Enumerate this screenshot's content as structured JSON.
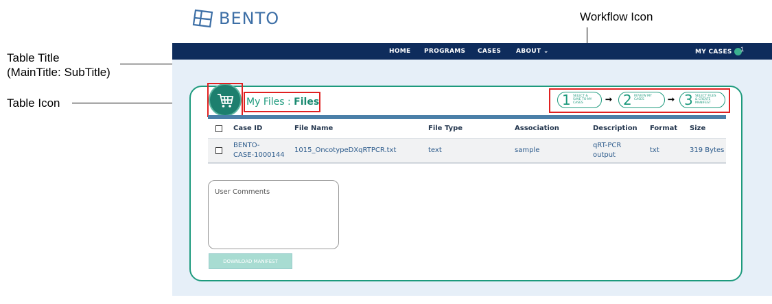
{
  "annotations": {
    "workflow_icon": "Workflow Icon",
    "table_title_line1": "Table Title",
    "table_title_line2": "(MainTitle: SubTitle)",
    "table_icon": "Table Icon"
  },
  "logo": {
    "text": "BENTO"
  },
  "nav": {
    "items": [
      "HOME",
      "PROGRAMS",
      "CASES",
      "ABOUT ⌄"
    ],
    "my_cases": "MY CASES",
    "cart_count": "1"
  },
  "title": {
    "main": "My Files : ",
    "sub": "Files"
  },
  "workflow": [
    {
      "num": "1",
      "text": "SELECT & SAVE TO MY CASES"
    },
    {
      "num": "2",
      "text": "REVIEW MY CASES"
    },
    {
      "num": "3",
      "text": "SELECT FILES & CREATE MANIFEST"
    }
  ],
  "table": {
    "headers": [
      "Case ID",
      "File Name",
      "File Type",
      "Association",
      "Description",
      "Format",
      "Size"
    ],
    "row": {
      "case_id": "BENTO-CASE-1000144",
      "case_id_l1": "BENTO-",
      "case_id_l2": "CASE-1000144",
      "file_name": "1015_OncotypeDXqRTPCR.txt",
      "file_type": "text",
      "association": "sample",
      "description_l1": "qRT-PCR",
      "description_l2": "output",
      "format": "txt",
      "size": "319 Bytes"
    }
  },
  "comments": {
    "label": "User Comments"
  },
  "download": {
    "label": "DOWNLOAD MANIFEST"
  },
  "colors": {
    "navy": "#0e2c5c",
    "teal": "#1d9a7d",
    "highlight_red": "#e02020",
    "background": "#e6eff8"
  }
}
